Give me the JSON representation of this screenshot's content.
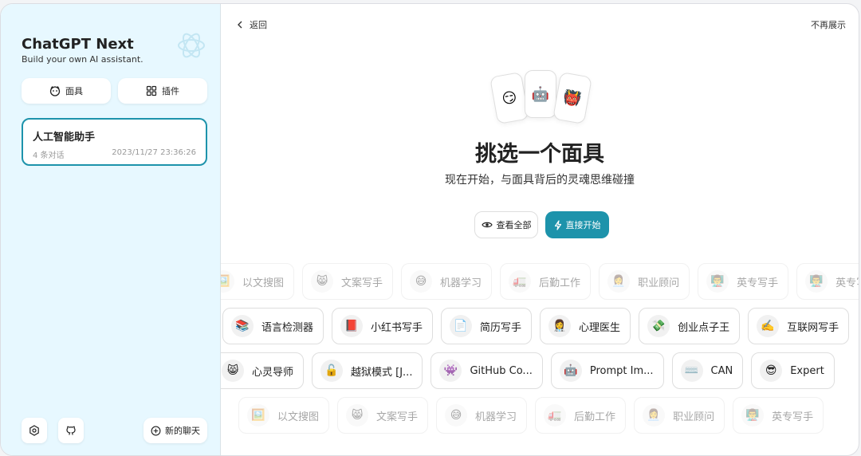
{
  "sidebar": {
    "title": "ChatGPT Next",
    "subtitle": "Build your own AI assistant.",
    "mask_button": "面具",
    "plugin_button": "插件",
    "chat": {
      "title": "人工智能助手",
      "count": "4 条对话",
      "time": "2023/11/27 23:36:26"
    },
    "new_chat": "新的聊天"
  },
  "header": {
    "back": "返回",
    "hide": "不再展示"
  },
  "hero": {
    "emojis": [
      "😏",
      "🤖",
      "👹"
    ],
    "title": "挑选一个面具",
    "subtitle": "现在开始，与面具背后的灵魂思维碰撞",
    "view_all": "查看全部",
    "start": "直接开始"
  },
  "rows": [
    [
      {
        "emoji": "🖼️",
        "name": "以文搜图"
      },
      {
        "emoji": "😸",
        "name": "文案写手"
      },
      {
        "emoji": "😅",
        "name": "机器学习"
      },
      {
        "emoji": "🚛",
        "name": "后勤工作"
      },
      {
        "emoji": "👩‍💼",
        "name": "职业顾问"
      },
      {
        "emoji": "👨‍🏫",
        "name": "英专写手"
      },
      {
        "emoji": "👨‍🏫",
        "name": "英专写手"
      }
    ],
    [
      {
        "emoji": "📚",
        "name": "语言检测器"
      },
      {
        "emoji": "📕",
        "name": "小红书写手"
      },
      {
        "emoji": "📄",
        "name": "简历写手"
      },
      {
        "emoji": "👩‍⚕️",
        "name": "心理医生"
      },
      {
        "emoji": "💸",
        "name": "创业点子王"
      },
      {
        "emoji": "✍️",
        "name": "互联网写手"
      }
    ],
    [
      {
        "emoji": "😸",
        "name": "心灵导师"
      },
      {
        "emoji": "🔓",
        "name": "越狱模式 [J..."
      },
      {
        "emoji": "👾",
        "name": "GitHub Co..."
      },
      {
        "emoji": "🤖",
        "name": "Prompt Im..."
      },
      {
        "emoji": "⌨️",
        "name": "CAN"
      },
      {
        "emoji": "😎",
        "name": "Expert"
      }
    ],
    [
      {
        "emoji": "🖼️",
        "name": "以文搜图"
      },
      {
        "emoji": "😸",
        "name": "文案写手"
      },
      {
        "emoji": "😅",
        "name": "机器学习"
      },
      {
        "emoji": "🚛",
        "name": "后勤工作"
      },
      {
        "emoji": "👩‍💼",
        "name": "职业顾问"
      },
      {
        "emoji": "👨‍🏫",
        "name": "英专写手"
      }
    ]
  ]
}
